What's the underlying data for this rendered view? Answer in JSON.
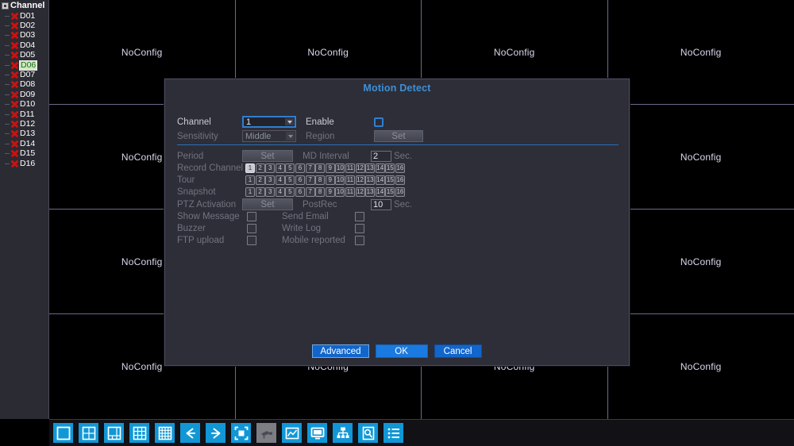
{
  "sidebar": {
    "root_label": "Channel",
    "channels": [
      {
        "name": "D01",
        "selected": false
      },
      {
        "name": "D02",
        "selected": false
      },
      {
        "name": "D03",
        "selected": false
      },
      {
        "name": "D04",
        "selected": false
      },
      {
        "name": "D05",
        "selected": false
      },
      {
        "name": "D06",
        "selected": true
      },
      {
        "name": "D07",
        "selected": false
      },
      {
        "name": "D08",
        "selected": false
      },
      {
        "name": "D09",
        "selected": false
      },
      {
        "name": "D10",
        "selected": false
      },
      {
        "name": "D11",
        "selected": false
      },
      {
        "name": "D12",
        "selected": false
      },
      {
        "name": "D13",
        "selected": false
      },
      {
        "name": "D14",
        "selected": false
      },
      {
        "name": "D15",
        "selected": false
      },
      {
        "name": "D16",
        "selected": false
      }
    ]
  },
  "wall": {
    "rows": 4,
    "cols": 4,
    "cell_label": "NoConfig"
  },
  "dialog": {
    "title": "Motion Detect",
    "channel_label": "Channel",
    "channel_value": "1",
    "enable_label": "Enable",
    "enable_checked": false,
    "sensitivity_label": "Sensitivity",
    "sensitivity_value": "Middle",
    "region_label": "Region",
    "region_button": "Set",
    "period_label": "Period",
    "period_button": "Set",
    "md_interval_label": "MD Interval",
    "md_interval_value": "2",
    "md_interval_unit": "Sec.",
    "record_channel_label": "Record Channel",
    "tour_label": "Tour",
    "snapshot_label": "Snapshot",
    "channel_numbers": [
      "1",
      "2",
      "3",
      "4",
      "5",
      "6",
      "7",
      "8",
      "9",
      "10",
      "11",
      "12",
      "13",
      "14",
      "15",
      "16"
    ],
    "record_channel_selected": [
      "1"
    ],
    "tour_selected": [],
    "snapshot_selected": [],
    "ptz_activation_label": "PTZ Activation",
    "ptz_button": "Set",
    "postrec_label": "PostRec",
    "postrec_value": "10",
    "postrec_unit": "Sec.",
    "show_message_label": "Show Message",
    "send_email_label": "Send Email",
    "buzzer_label": "Buzzer",
    "write_log_label": "Write Log",
    "ftp_upload_label": "FTP upload",
    "mobile_reported_label": "Mobile reported",
    "advanced_button": "Advanced",
    "ok_button": "OK",
    "cancel_button": "Cancel"
  },
  "taskbar": {
    "items": [
      {
        "icon": "view-single-icon",
        "disabled": false
      },
      {
        "icon": "view-four-split-icon",
        "disabled": false
      },
      {
        "icon": "view-six-split-icon",
        "disabled": false
      },
      {
        "icon": "view-nine-split-icon",
        "disabled": false
      },
      {
        "icon": "view-sixteen-split-icon",
        "disabled": false
      },
      {
        "icon": "arrow-left-icon",
        "disabled": false
      },
      {
        "icon": "arrow-right-icon",
        "disabled": false
      },
      {
        "icon": "pip-icon",
        "disabled": false
      },
      {
        "icon": "camera-icon",
        "disabled": true
      },
      {
        "icon": "playback-chart-icon",
        "disabled": false
      },
      {
        "icon": "monitor-icon",
        "disabled": false
      },
      {
        "icon": "network-tree-icon",
        "disabled": false
      },
      {
        "icon": "hdd-search-icon",
        "disabled": false
      },
      {
        "icon": "main-menu-list-icon",
        "disabled": false
      }
    ]
  },
  "colors": {
    "accent_blue": "#1197d6",
    "title_blue": "#3d8fd6",
    "button_blue": "#1166cc",
    "selected_green": "#1d6b1d",
    "x_red": "#cc1111"
  }
}
